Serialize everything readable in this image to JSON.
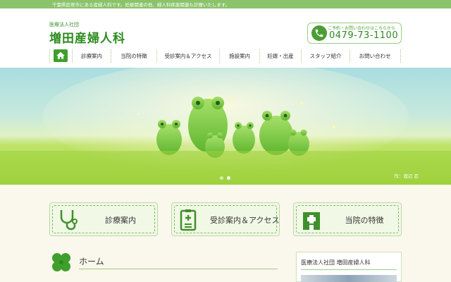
{
  "topbar": {
    "text": "千葉県匝瑳市にある産婦人科です。妊娠関連の他、婦人科疾患関連も診療いたします。"
  },
  "header": {
    "corp": "医療法人社団",
    "clinic_name": "増田産婦人科",
    "phone_note": "ご予約・お問い合わせはこちらから",
    "phone": "0479-73-1100"
  },
  "nav": {
    "items": [
      "診療案内",
      "当院の特徴",
      "受診案内＆アクセス",
      "施設案内",
      "妊娠・出産",
      "スタッフ紹介",
      "お問い合わせ"
    ]
  },
  "hero": {
    "credit": "作：渡辺 忍",
    "slides": 2,
    "active_slide": 2
  },
  "features": [
    {
      "label": "診療案内",
      "icon": "stethoscope-icon"
    },
    {
      "label": "受診案内＆アクセス",
      "icon": "medical-chart-icon"
    },
    {
      "label": "当院の特徴",
      "icon": "hospital-icon"
    }
  ],
  "main": {
    "heading": "ホーム"
  },
  "sidebar": {
    "title": "医療法人社団 増田産婦人科"
  },
  "colors": {
    "brand_green": "#2d8a1d",
    "accent_green": "#8bc36a",
    "background": "#faf7ec"
  }
}
